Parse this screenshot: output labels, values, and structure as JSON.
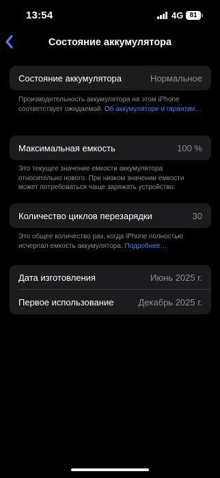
{
  "status": {
    "time": "13:54",
    "network": "4G",
    "battery": "81"
  },
  "nav": {
    "title": "Состояние аккумулятора"
  },
  "health": {
    "label": "Состояние аккумулятора",
    "value": "Нормальное",
    "note": "Производительность аккумулятора на этом iPhone соответствует ожидаемой.",
    "link": "Об аккумуляторе и гарантии…"
  },
  "capacity": {
    "label": "Максимальная емкость",
    "value": "100 %",
    "note": "Это текущее значение емкости аккумулятора относительно нового. При низком значении емкости может потребоваться чаще заряжать устройство."
  },
  "cycles": {
    "label": "Количество циклов перезарядки",
    "value": "30",
    "note": "Это общее количество раз, когда iPhone полностью исчерпал емкость аккумулятора.",
    "link": "Подробнее…"
  },
  "dates": {
    "manufacture_label": "Дата изготовления",
    "manufacture_value": "Июнь 2025 г.",
    "first_use_label": "Первое использование",
    "first_use_value": "Декабрь 2025 г."
  },
  "colors": {
    "background": "#000000",
    "card": "#1c1c1e",
    "secondary_text": "#8e8e93",
    "link": "#3d8bfd"
  }
}
